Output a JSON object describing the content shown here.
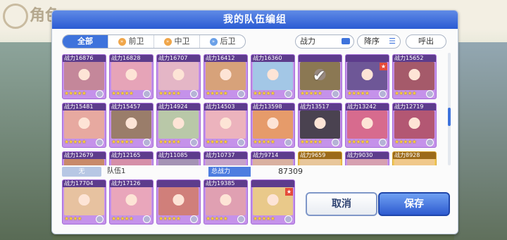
{
  "background": {
    "title": "角色"
  },
  "dialog": {
    "title": "我的队伍编组"
  },
  "tabs": [
    {
      "label": "全部",
      "active": true
    },
    {
      "label": "前卫",
      "active": false
    },
    {
      "label": "中卫",
      "active": false
    },
    {
      "label": "后卫",
      "active": false
    }
  ],
  "sort": {
    "power_label": "战力",
    "order_label": "降序",
    "out_label": "呼出"
  },
  "power_prefix": "战力",
  "roster": [
    {
      "power": "16876",
      "color": "#c4879a",
      "stars": "★★★★★"
    },
    {
      "power": "16828",
      "color": "#e6a4b8",
      "stars": "★★★★★"
    },
    {
      "power": "16707",
      "color": "#e4b6c6",
      "stars": "★★★★★"
    },
    {
      "power": "16412",
      "color": "#d7a27a",
      "stars": "★★★★★"
    },
    {
      "power": "16360",
      "color": "#a3c7e6",
      "stars": "★★★★★"
    },
    {
      "power": "",
      "color": "#e7c88a",
      "stars": "★★★★★",
      "selected": true
    },
    {
      "power": "",
      "color": "#6e5797",
      "stars": "★★★★★",
      "tag": true
    },
    {
      "power": "15652",
      "color": "#a55a6a",
      "stars": "★★★★★"
    },
    {
      "power": "15481",
      "color": "#e7a9a0",
      "stars": "★★★★★"
    },
    {
      "power": "15457",
      "color": "#9a7d6a",
      "stars": "★★★★★"
    },
    {
      "power": "14924",
      "color": "#b9c8a8",
      "stars": "★★★★★"
    },
    {
      "power": "14503",
      "color": "#ecb3bd",
      "stars": "★★★★★"
    },
    {
      "power": "13598",
      "color": "#e69b6a",
      "stars": "★★★★★"
    },
    {
      "power": "13517",
      "color": "#4a4250",
      "stars": "★★★★★"
    },
    {
      "power": "13242",
      "color": "#d76b8e",
      "stars": "★★★★★"
    },
    {
      "power": "12719",
      "color": "#b35773",
      "stars": "★★★★★"
    },
    {
      "power": "12679",
      "color": "#c88a6a",
      "stars": "★★★★★"
    },
    {
      "power": "12165",
      "color": "#d58fa8",
      "stars": "★★★★★"
    },
    {
      "power": "11085",
      "color": "#a493b4",
      "stars": "★★★★★"
    },
    {
      "power": "10737",
      "color": "#c6a3c8",
      "stars": "★★★★★"
    },
    {
      "power": "9714",
      "color": "#d9b0a0",
      "stars": "★★★★★"
    },
    {
      "power": "9659",
      "color": "#e8c69a",
      "stars": "★★★★★",
      "gold": true
    },
    {
      "power": "9030",
      "color": "#d6a0b0",
      "stars": "★★★★★"
    },
    {
      "power": "8928",
      "color": "#f0c88a",
      "stars": "★★★★★",
      "gold": true
    }
  ],
  "team_bar": {
    "pill": "无",
    "name": "队伍1",
    "total_label": "总战力",
    "total_value": "87309"
  },
  "team": [
    {
      "power": "17704",
      "color": "#e7c2a0",
      "stars": "★★★★"
    },
    {
      "power": "17126",
      "color": "#e9a6bb",
      "stars": "★★★★★"
    },
    {
      "power": "",
      "color": "#d07f7a",
      "stars": "★★★★★"
    },
    {
      "power": "19385",
      "color": "#e0a0b2",
      "stars": "★★★★★"
    },
    {
      "power": "",
      "color": "#e9c98a",
      "stars": "★★★★★",
      "tag": true
    }
  ],
  "buttons": {
    "cancel": "取消",
    "save": "保存"
  }
}
